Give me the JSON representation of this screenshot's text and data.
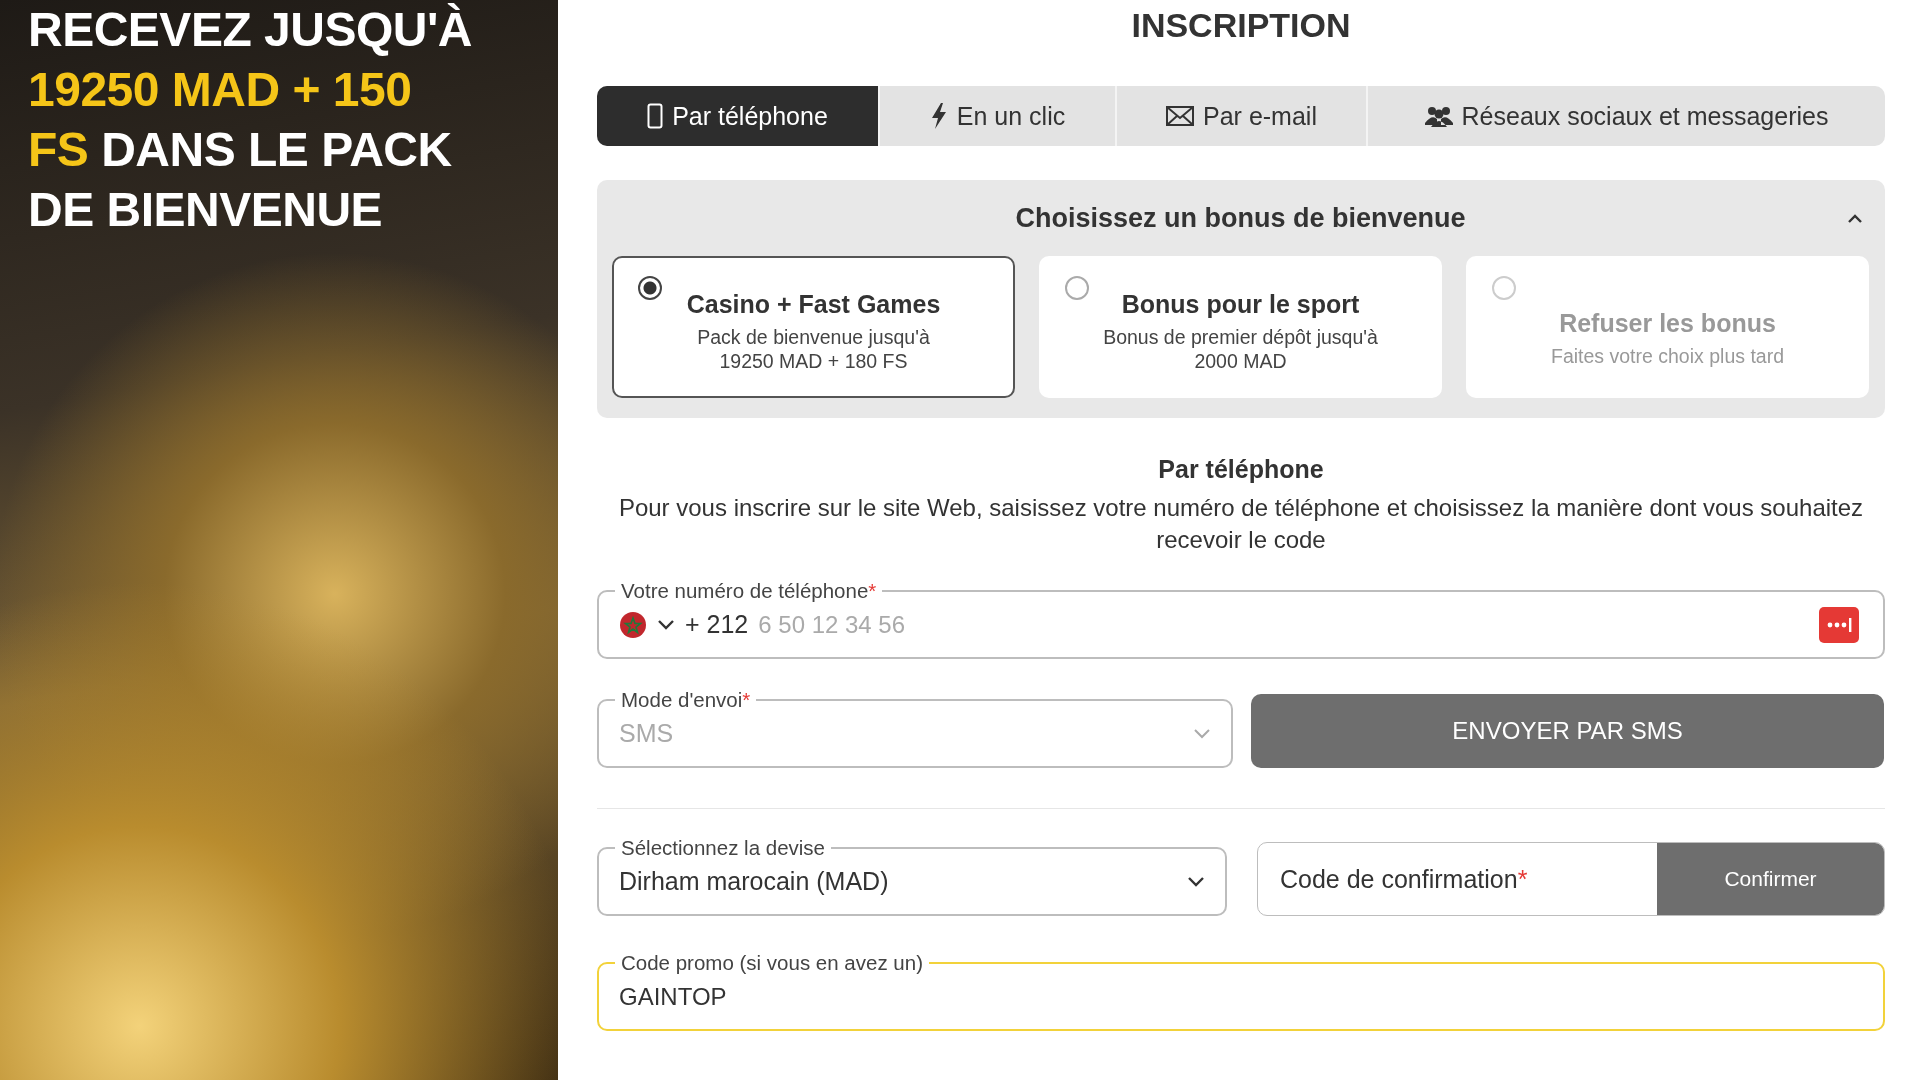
{
  "banner": {
    "headline": [
      {
        "text": "RECEVEZ JUSQU'À",
        "highlight": false
      },
      {
        "text": "19250 MAD + 150 FS",
        "highlight": true
      },
      {
        "text": "DANS LE PACK DE BIENVENUE",
        "highlight": false
      }
    ]
  },
  "form": {
    "title": "INSCRIPTION",
    "tabs": [
      {
        "label": "Par téléphone",
        "selected": true
      },
      {
        "label": "En un clic",
        "selected": false
      },
      {
        "label": "Par e-mail",
        "selected": false
      },
      {
        "label": "Réseaux sociaux et messageries",
        "selected": false
      }
    ],
    "bonus": {
      "title": "Choisissez un bonus de bienvenue",
      "expanded": true,
      "options": [
        {
          "title": "Casino + Fast Games",
          "description": "Pack de bienvenue jusqu'à 19250 MAD + 180 FS",
          "selected": true,
          "muted": false
        },
        {
          "title": "Bonus pour le sport",
          "description": "Bonus de premier dépôt jusqu'à 2000 MAD",
          "selected": false,
          "muted": false
        },
        {
          "title": "Refuser les bonus",
          "description": "Faites votre choix plus tard",
          "selected": false,
          "muted": true
        }
      ]
    },
    "method": {
      "title": "Par téléphone",
      "description": "Pour vous inscrire sur le site Web, saisissez votre numéro de téléphone et choisissez la manière dont vous souhaitez recevoir le code"
    },
    "phone": {
      "label": "Votre numéro de téléphone",
      "required_mark": "*",
      "country_code": "+ 212",
      "placeholder": "6 50 12 34 56"
    },
    "delivery": {
      "label": "Mode d'envoi",
      "required_mark": "*",
      "value": "SMS",
      "disabled": true
    },
    "send_button": "ENVOYER PAR SMS",
    "currency": {
      "label": "Sélectionnez la devise",
      "value": "Dirham marocain (MAD)"
    },
    "confirmation": {
      "placeholder": "Code de confirmation",
      "required_mark": "*",
      "button": "Confirmer"
    },
    "promo": {
      "label": "Code promo (si vous en avez un)",
      "value": "GAINTOP",
      "focused": true
    }
  }
}
